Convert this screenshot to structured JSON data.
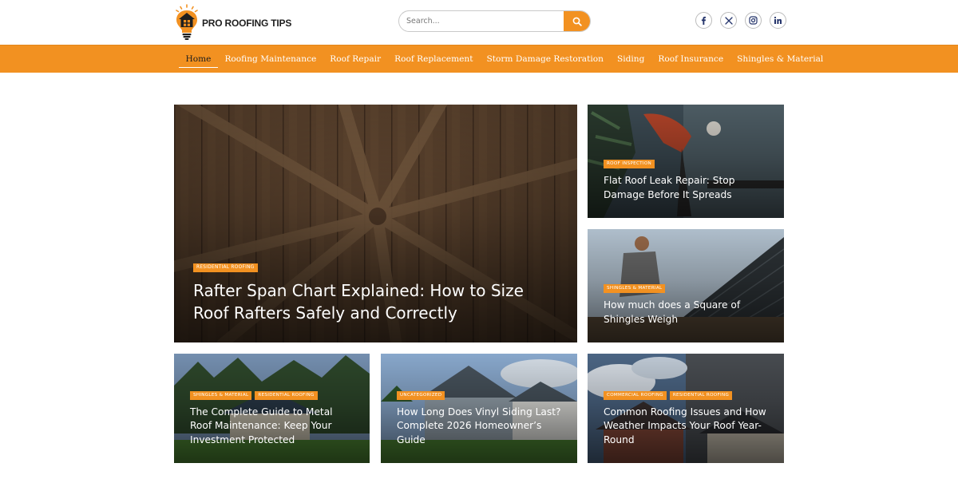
{
  "site": {
    "name": "PRO ROOFING TIPS"
  },
  "search": {
    "placeholder": "Search..."
  },
  "socials": [
    "facebook-icon",
    "x-icon",
    "instagram-icon",
    "linkedin-icon"
  ],
  "nav": {
    "items": [
      "Home",
      "Roofing Maintenance",
      "Roof Repair",
      "Roof Replacement",
      "Storm Damage Restoration",
      "Siding",
      "Roof Insurance",
      "Shingles & Material"
    ],
    "active": "Home"
  },
  "colors": {
    "accent": "#f29121",
    "nav_active_text": "#1d1d1d",
    "card_text": "#ffffff"
  },
  "posts": {
    "hero": {
      "tags": [
        "RESIDENTIAL ROOFING"
      ],
      "title": "Rafter Span Chart Explained: How to Size Roof Rafters Safely and Correctly"
    },
    "side1": {
      "tags": [
        "ROOF INSPECTION"
      ],
      "title": "Flat Roof Leak Repair: Stop Damage Before It Spreads"
    },
    "side2": {
      "tags": [
        "SHINGLES & MATERIAL"
      ],
      "title": "How much does a Square of Shingles Weigh"
    },
    "bottom1": {
      "tags": [
        "SHINGLES & MATERIAL",
        "RESIDENTIAL ROOFING"
      ],
      "title": "The Complete Guide to Metal Roof Maintenance: Keep Your Investment Protected"
    },
    "bottom2": {
      "tags": [
        "UNCATEGORIZED"
      ],
      "title": "How Long Does Vinyl Siding Last? Complete 2026 Homeowner’s Guide"
    },
    "bottom3": {
      "tags": [
        "COMMERCIAL ROOFING",
        "RESIDENTIAL ROOFING"
      ],
      "title": "Common Roofing Issues and How Weather Impacts Your Roof Year-Round"
    }
  }
}
